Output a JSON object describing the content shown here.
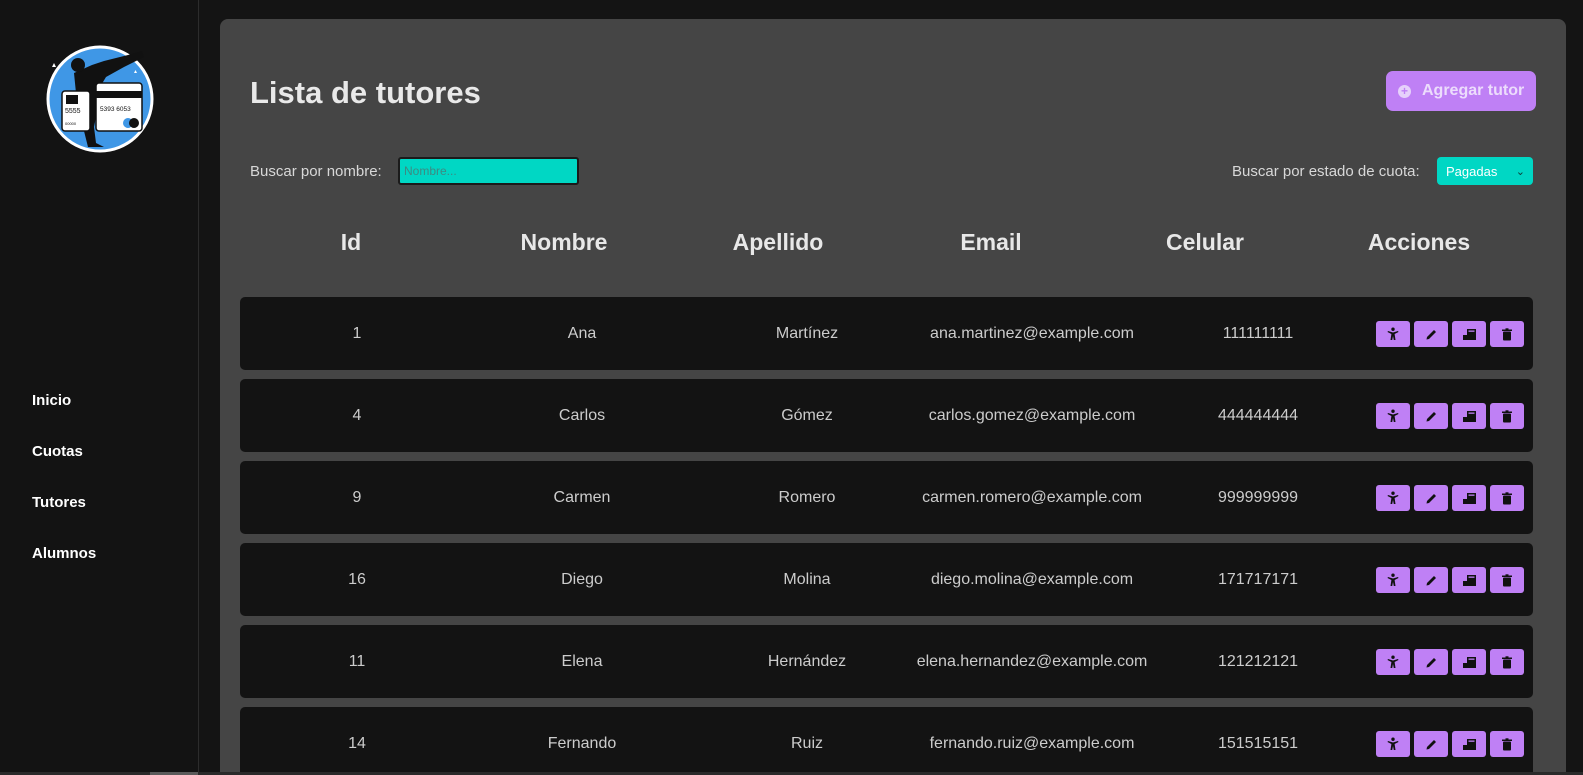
{
  "sidebar": {
    "logo_icon": "karate-kick-payment-card-logo",
    "logo_card_texts": [
      "5555",
      "5393 6053",
      "00000"
    ],
    "nav": [
      {
        "label": "Inicio"
      },
      {
        "label": "Cuotas"
      },
      {
        "label": "Tutores"
      },
      {
        "label": "Alumnos"
      }
    ]
  },
  "header": {
    "title": "Lista de tutores",
    "add_button": {
      "icon": "plus-circle-icon",
      "label": "Agregar tutor"
    }
  },
  "filters": {
    "name_label": "Buscar por nombre:",
    "name_placeholder": "Nombre...",
    "name_value": "",
    "status_label": "Buscar por estado de cuota:",
    "status_selected": "Pagadas"
  },
  "table": {
    "columns": [
      "Id",
      "Nombre",
      "Apellido",
      "Email",
      "Celular",
      "Acciones"
    ],
    "action_icons": [
      "karate-figure-icon",
      "pencil-icon",
      "payment-icon",
      "trash-icon"
    ],
    "rows": [
      {
        "id": "1",
        "nombre": "Ana",
        "apellido": "Martínez",
        "email": "ana.martinez@example.com",
        "celular": "111111111"
      },
      {
        "id": "4",
        "nombre": "Carlos",
        "apellido": "Gómez",
        "email": "carlos.gomez@example.com",
        "celular": "444444444"
      },
      {
        "id": "9",
        "nombre": "Carmen",
        "apellido": "Romero",
        "email": "carmen.romero@example.com",
        "celular": "999999999"
      },
      {
        "id": "16",
        "nombre": "Diego",
        "apellido": "Molina",
        "email": "diego.molina@example.com",
        "celular": "171717171"
      },
      {
        "id": "11",
        "nombre": "Elena",
        "apellido": "Hernández",
        "email": "elena.hernandez@example.com",
        "celular": "121212121"
      },
      {
        "id": "14",
        "nombre": "Fernando",
        "apellido": "Ruiz",
        "email": "fernando.ruiz@example.com",
        "celular": "151515151"
      }
    ]
  },
  "colors": {
    "accent": "#bf80f5",
    "input": "#00d7c4",
    "panel": "#454545",
    "row": "#131313",
    "background": "#141414"
  }
}
